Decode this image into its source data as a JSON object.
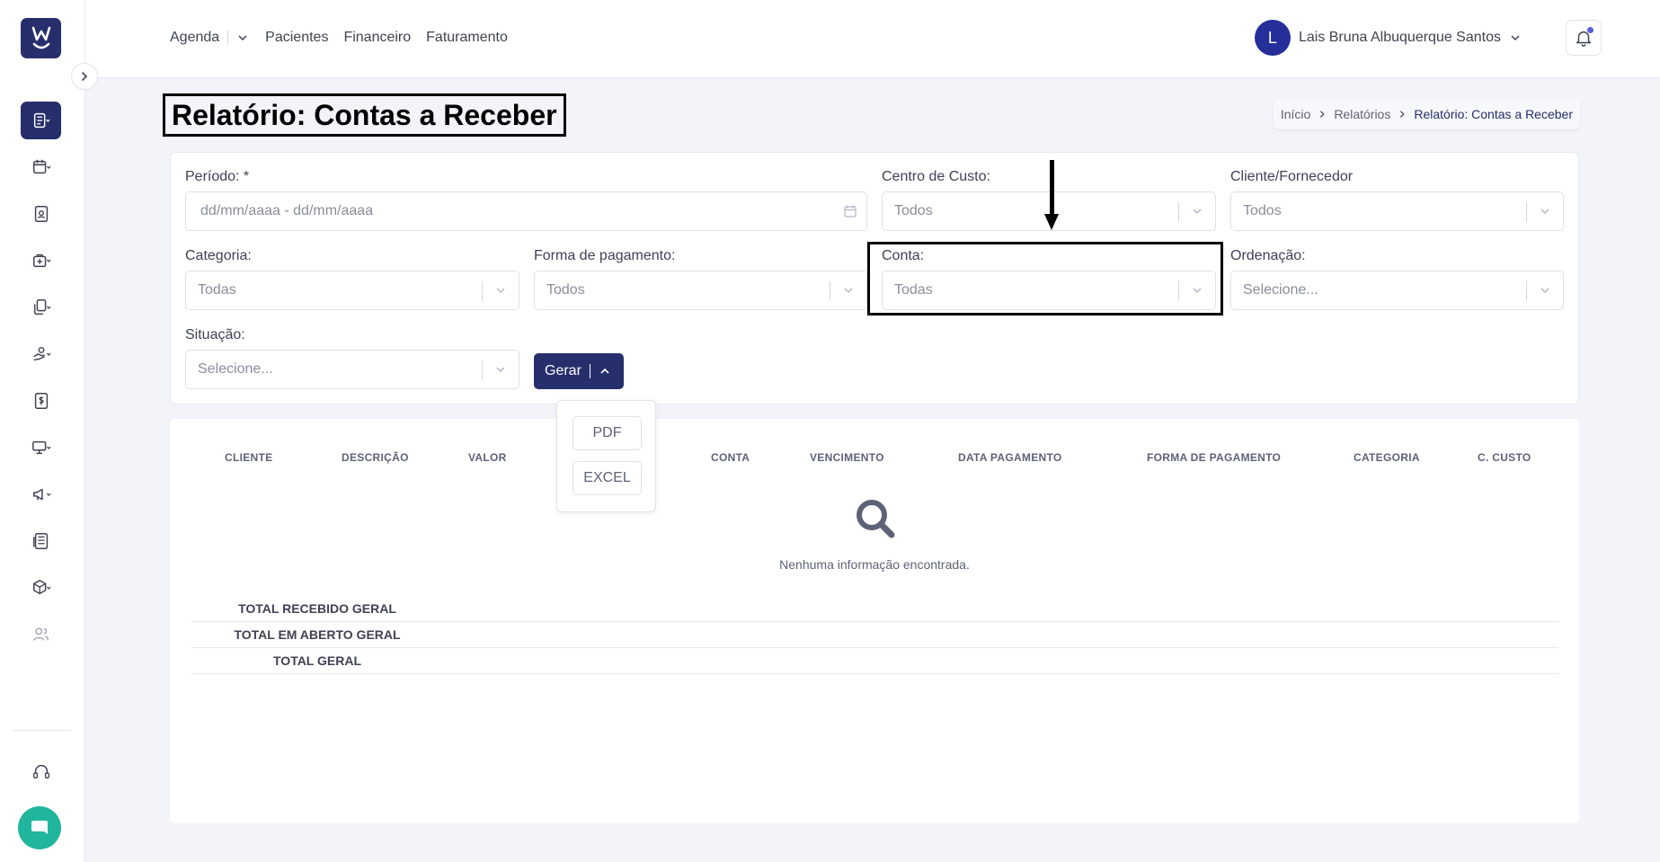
{
  "nav": {
    "agenda": "Agenda",
    "pacientes": "Pacientes",
    "financeiro": "Financeiro",
    "faturamento": "Faturamento"
  },
  "user": {
    "initial": "L",
    "name": "Lais Bruna Albuquerque Santos"
  },
  "page": {
    "title": "Relatório: Contas a Receber"
  },
  "breadcrumb": {
    "home": "Início",
    "reports": "Relatórios",
    "current": "Relatório: Contas a Receber"
  },
  "filters": {
    "periodo_label": "Período: *",
    "periodo_placeholder": "dd/mm/aaaa - dd/mm/aaaa",
    "centro_custo_label": "Centro de Custo:",
    "centro_custo_value": "Todos",
    "cliente_label": "Cliente/Fornecedor",
    "cliente_value": "Todos",
    "categoria_label": "Categoria:",
    "categoria_value": "Todas",
    "forma_label": "Forma de pagamento:",
    "forma_value": "Todos",
    "conta_label": "Conta:",
    "conta_value": "Todas",
    "ordenacao_label": "Ordenação:",
    "ordenacao_value": "Selecione...",
    "situacao_label": "Situação:",
    "situacao_value": "Selecione..."
  },
  "actions": {
    "gerar_label": "Gerar",
    "pdf_label": "PDF",
    "excel_label": "EXCEL"
  },
  "table": {
    "columns": [
      "CLIENTE",
      "DESCRIÇÃO",
      "VALOR",
      "CONTA",
      "VENCIMENTO",
      "DATA PAGAMENTO",
      "FORMA DE PAGAMENTO",
      "CATEGORIA",
      "C. CUSTO"
    ],
    "empty_message": "Nenhuma informação encontrada.",
    "totals": [
      "TOTAL RECEBIDO GERAL",
      "TOTAL EM ABERTO GERAL",
      "TOTAL GERAL"
    ]
  },
  "colors": {
    "brand": "#262e6b",
    "chat": "#20b59d",
    "notification_dot": "#5960d8"
  }
}
